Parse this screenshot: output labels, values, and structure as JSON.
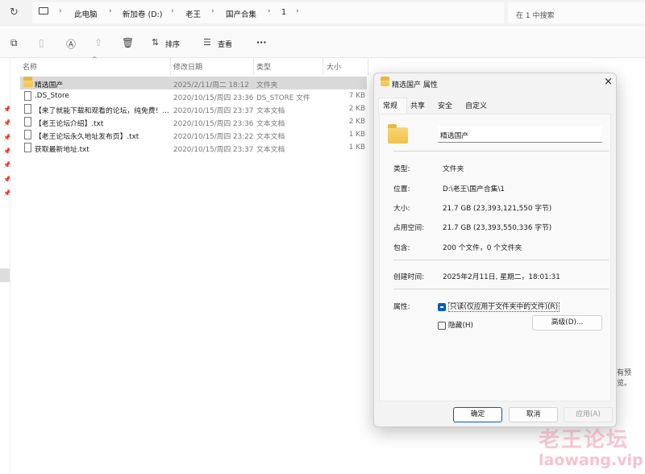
{
  "address": {
    "crumbs": [
      "此电脑",
      "新加卷 (D:)",
      "老王",
      "国产合集",
      "1"
    ],
    "search_placeholder": "在 1 中搜索"
  },
  "toolbar": {
    "sort": "排序",
    "view": "查看",
    "more": "···"
  },
  "columns": [
    "名称",
    "修改日期",
    "类型",
    "大小"
  ],
  "files": [
    {
      "name": "精选国产",
      "date": "2025/2/11/周二 18:12",
      "type": "文件夹",
      "size": "",
      "icon": "folder-icon"
    },
    {
      "name": ".DS_Store",
      "date": "2020/10/15/周四 23:36",
      "type": "DS_STORE 文件",
      "size": "7 KB",
      "icon": "file-icon"
    },
    {
      "name": "【来了就能下载和观看的论坛，纯免费！...",
      "date": "2020/10/15/周四 23:37",
      "type": "文本文档",
      "size": "2 KB",
      "icon": "text-file-icon"
    },
    {
      "name": "【老王论坛介绍】.txt",
      "date": "2020/10/15/周四 23:36",
      "type": "文本文档",
      "size": "2 KB",
      "icon": "text-file-icon"
    },
    {
      "name": "【老王论坛永久地址发布页】.txt",
      "date": "2020/10/15/周四 23:22",
      "type": "文本文档",
      "size": "1 KB",
      "icon": "text-file-icon"
    },
    {
      "name": "获取最新地址.txt",
      "date": "2020/10/15/周四 23:37",
      "type": "文本文档",
      "size": "1 KB",
      "icon": "text-file-icon"
    }
  ],
  "preview_text": "有预览。",
  "dialog": {
    "title": "精选国产 属性",
    "tabs": [
      "常规",
      "共享",
      "安全",
      "自定义"
    ],
    "name": "精选国产",
    "props": [
      {
        "label": "类型:",
        "value": "文件夹"
      },
      {
        "label": "位置:",
        "value": "D:\\老王\\国产合集\\1"
      },
      {
        "label": "大小:",
        "value": "21.7 GB (23,393,121,550 字节)"
      },
      {
        "label": "占用空间:",
        "value": "21.7 GB (23,393,550,336 字节)"
      },
      {
        "label": "包含:",
        "value": "200 个文件，0 个文件夹"
      }
    ],
    "created_label": "创建时间:",
    "created": "2025年2月11日, 星期二，18:01:31",
    "attr_label": "属性:",
    "readonly": "只读(仅应用于文件夹中的文件)(R)",
    "hidden": "隐藏(H)",
    "advanced": "高级(D)...",
    "ok": "确定",
    "cancel": "取消",
    "apply": "应用(A)"
  },
  "watermark": {
    "cn": "老王论坛",
    "url": "laowang.vip"
  },
  "colors": {
    "accent": "#005fb8",
    "selection": "#d9d9d9"
  }
}
